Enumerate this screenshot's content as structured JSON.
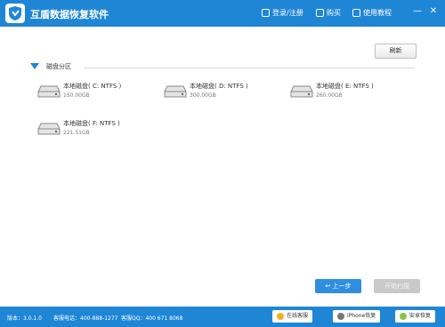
{
  "app": {
    "title": "互盾数据恢复软件"
  },
  "header": {
    "login_label": "登录/注册",
    "buy_label": "购买",
    "tutorial_label": "使用教程"
  },
  "toolbar": {
    "refresh_label": "刷新"
  },
  "section": {
    "title": "磁盘分区"
  },
  "drives": [
    {
      "name": "本地磁盘( C: NTFS )",
      "size": "150.00GB"
    },
    {
      "name": "本地磁盘( D: NTFS )",
      "size": "300.00GB"
    },
    {
      "name": "本地磁盘( E: NTFS )",
      "size": "260.00GB"
    },
    {
      "name": "本地磁盘( F: NTFS )",
      "size": "221.51GB"
    }
  ],
  "actions": {
    "back_label": "上一步",
    "scan_label": "开始扫描"
  },
  "footer": {
    "version": "版本：3.0.1.0",
    "phone": "客服电话：400-888-1277",
    "qq": "客服QQ：400 671 8068",
    "online_service": "在线客服",
    "iphone_recovery": "iPhone恢复",
    "android_recovery": "安卓恢复"
  },
  "colors": {
    "accent": "#1f86d6",
    "button_blue": "#2f8ee0",
    "disabled": "#c9c9c9"
  }
}
